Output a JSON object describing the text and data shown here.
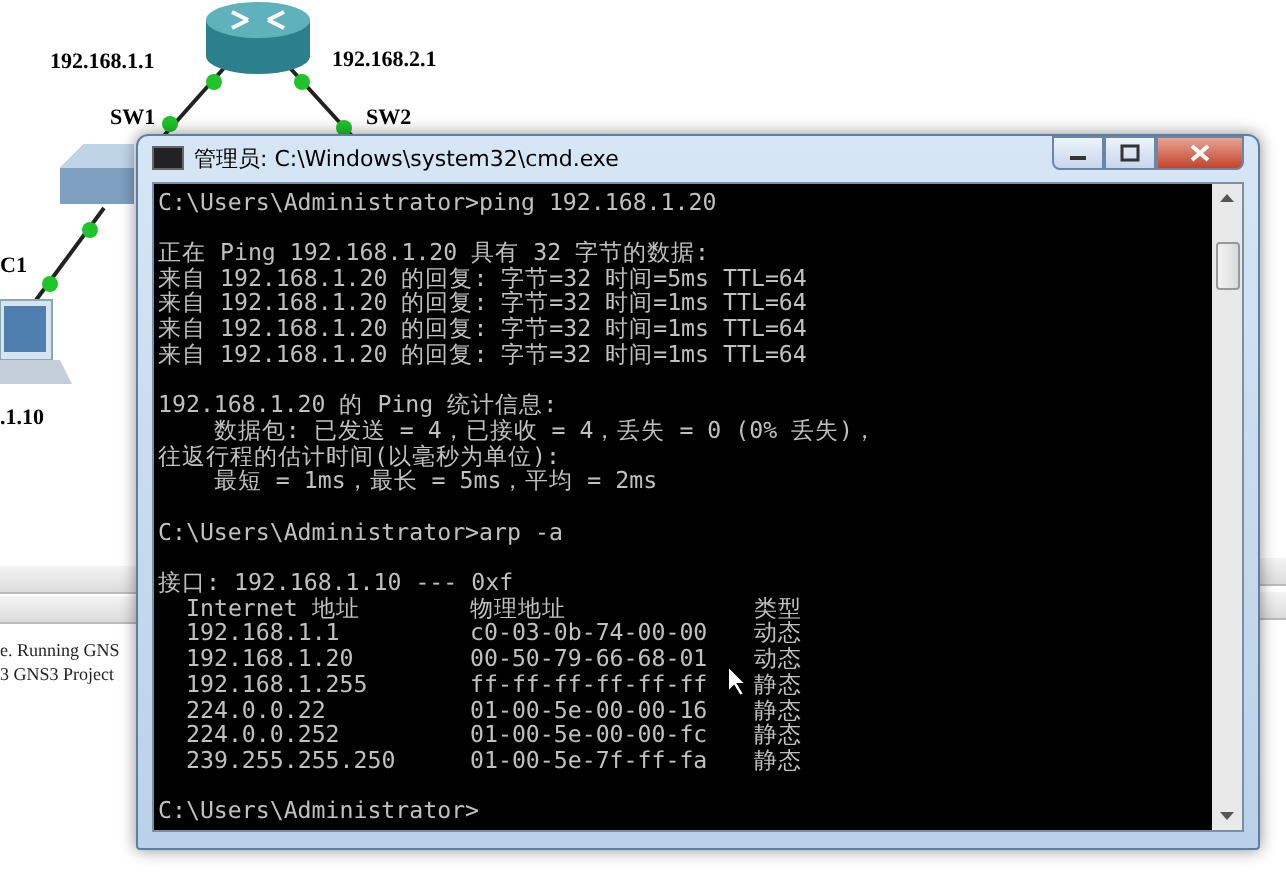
{
  "topology": {
    "router_labels": [
      "192.168.1.1",
      "192.168.2.1"
    ],
    "switch_labels": [
      "SW1",
      "SW2"
    ],
    "host_label": "C1",
    "host_address": ".1.10"
  },
  "side_panel": {
    "log_lines": [
      "e. Running GNS",
      "3 GNS3 Project"
    ]
  },
  "cmd_window": {
    "title": "管理员: C:\\Windows\\system32\\cmd.exe",
    "blocks": [
      [
        "C:\\Users\\Administrator>ping 192.168.1.20"
      ],
      [
        "正在 Ping 192.168.1.20 具有 32 字节的数据:",
        "来自 192.168.1.20 的回复: 字节=32 时间=5ms TTL=64",
        "来自 192.168.1.20 的回复: 字节=32 时间=1ms TTL=64",
        "来自 192.168.1.20 的回复: 字节=32 时间=1ms TTL=64",
        "来自 192.168.1.20 的回复: 字节=32 时间=1ms TTL=64"
      ],
      [
        "192.168.1.20 的 Ping 统计信息:",
        "    数据包: 已发送 = 4，已接收 = 4，丢失 = 0 (0% 丢失)，",
        "往返行程的估计时间(以毫秒为单位):",
        "    最短 = 1ms，最长 = 5ms，平均 = 2ms"
      ],
      [
        "C:\\Users\\Administrator>arp -a"
      ]
    ],
    "arp_table": {
      "interface": "接口: 192.168.1.10 --- 0xf",
      "columns": [
        "Internet 地址",
        "物理地址",
        "类型"
      ],
      "rows": [
        [
          "192.168.1.1",
          "c0-03-0b-74-00-00",
          "动态"
        ],
        [
          "192.168.1.20",
          "00-50-79-66-68-01",
          "动态"
        ],
        [
          "192.168.1.255",
          "ff-ff-ff-ff-ff-ff",
          "静态"
        ],
        [
          "224.0.0.22",
          "01-00-5e-00-00-16",
          "静态"
        ],
        [
          "224.0.0.252",
          "01-00-5e-00-00-fc",
          "静态"
        ],
        [
          "239.255.255.250",
          "01-00-5e-7f-ff-fa",
          "静态"
        ]
      ]
    },
    "final_prompt": "C:\\Users\\Administrator>"
  }
}
